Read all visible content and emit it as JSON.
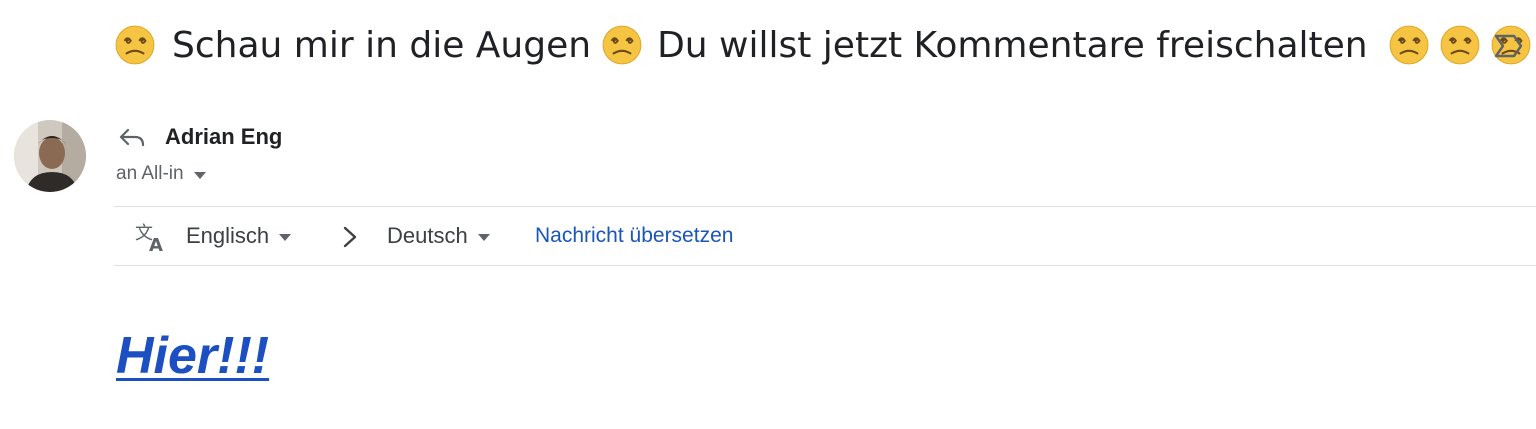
{
  "subject": {
    "part1": "Schau mir in die Augen",
    "part2": "Du willst jetzt Kommentare freischalten",
    "emoji": "dizzy-face-emoji"
  },
  "sender": {
    "name": "Adrian Eng",
    "recipient": "an All-in"
  },
  "translate": {
    "from_language": "Englisch",
    "to_language": "Deutsch",
    "action_label": "Nachricht übersetzen"
  },
  "body": {
    "link_text": "Hier!!!"
  },
  "colors": {
    "link": "#1a56b8",
    "body_link": "#1c4fc1",
    "text": "#202124",
    "muted": "#5f6368",
    "emoji": "#f5c443"
  },
  "icons": [
    "dizzy-face-emoji",
    "important-marker-icon",
    "avatar",
    "reply-icon",
    "translate-icon",
    "chevron-right-icon",
    "chevron-down-icon"
  ]
}
